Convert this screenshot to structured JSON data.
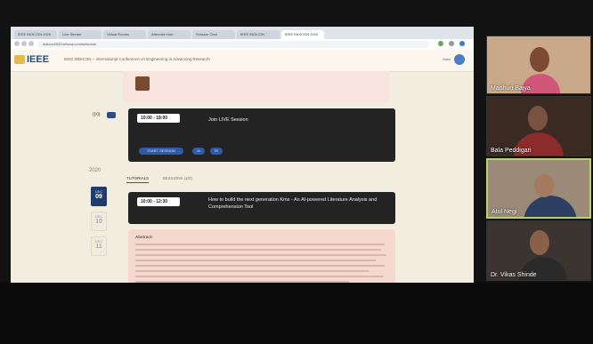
{
  "browser": {
    "tabs": [
      {
        "label": "IEEE INDICON 2020"
      },
      {
        "label": "Live Stream"
      },
      {
        "label": "Virtual Rooms"
      },
      {
        "label": "Attendee Hub"
      },
      {
        "label": "Session Chat"
      },
      {
        "label": "IEEE INDICON"
      },
      {
        "label": "IEEE INDICON 2020"
      }
    ],
    "address": "indicon2020.whova.com/schedule"
  },
  "site": {
    "logo": "IEEE",
    "title": "IEEE INDICON – International Conference on Engineering in Advancing Research",
    "user_label": "Main"
  },
  "session_live": {
    "time": "10:00 - 18:00",
    "label": "Join LIVE Session",
    "actions": [
      "START SESSION",
      "M",
      "M"
    ]
  },
  "schedule": {
    "year": "2020",
    "tabs": [
      "TUTORIALS",
      "SESSIONS (2/3)"
    ],
    "dates": [
      {
        "month": "DEC",
        "day": "09",
        "selected": true
      },
      {
        "month": "DEC",
        "day": "10",
        "selected": false
      },
      {
        "month": "DEC",
        "day": "11",
        "selected": false
      }
    ]
  },
  "tutorial": {
    "time": "10:00 - 12:30",
    "title": "How to build the next generation Kms - An AI-powered Literature Analysis and Comprehension Tool",
    "abstract_heading": "Abstract:"
  },
  "participants": [
    {
      "name": "Madhuri Bajya",
      "active": false
    },
    {
      "name": "Bala Peddigari",
      "active": false
    },
    {
      "name": "Atul Negi",
      "active": true
    },
    {
      "name": "Dr. Vikas Shinde",
      "active": false
    }
  ]
}
